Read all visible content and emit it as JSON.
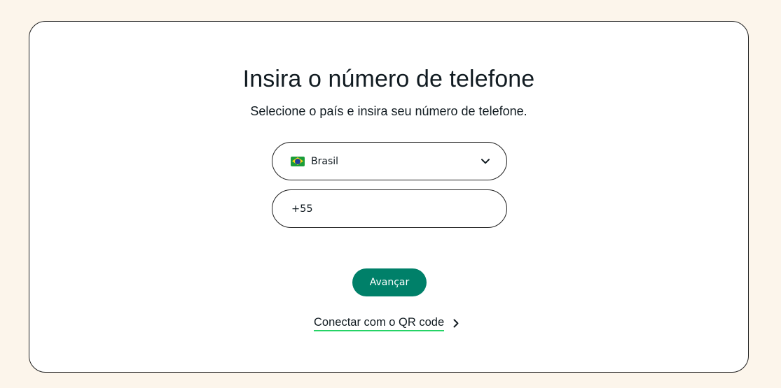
{
  "page": {
    "title": "Insira o número de telefone",
    "subtitle": "Selecione o país e insira seu número de telefone."
  },
  "country_select": {
    "flag_icon": "brazil-flag-icon",
    "selected": "Brasil",
    "dropdown_icon": "chevron-down-icon"
  },
  "phone": {
    "value": "+55"
  },
  "actions": {
    "next_label": "Avançar",
    "qr_link_label": "Conectar com o QR code",
    "qr_link_icon": "chevron-right-icon"
  },
  "colors": {
    "background": "#fcf5eb",
    "primary_button": "#008069",
    "link_underline": "#25d366"
  }
}
